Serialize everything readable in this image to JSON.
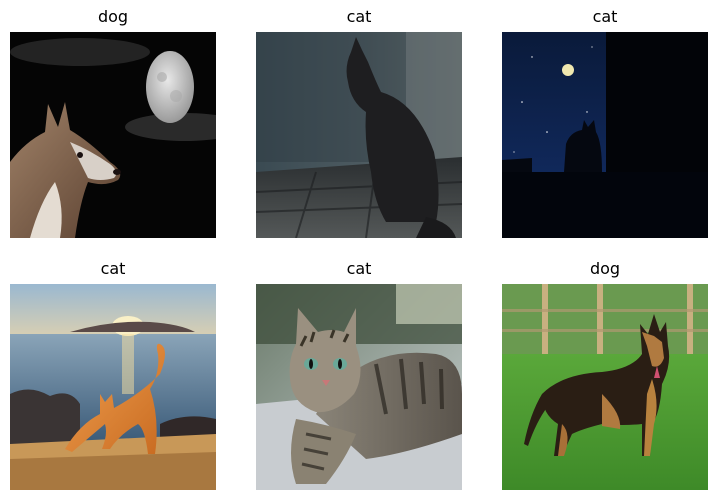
{
  "grid": {
    "items": [
      {
        "label": "dog"
      },
      {
        "label": "cat"
      },
      {
        "label": "cat"
      },
      {
        "label": "cat"
      },
      {
        "label": "cat"
      },
      {
        "label": "dog"
      }
    ]
  }
}
